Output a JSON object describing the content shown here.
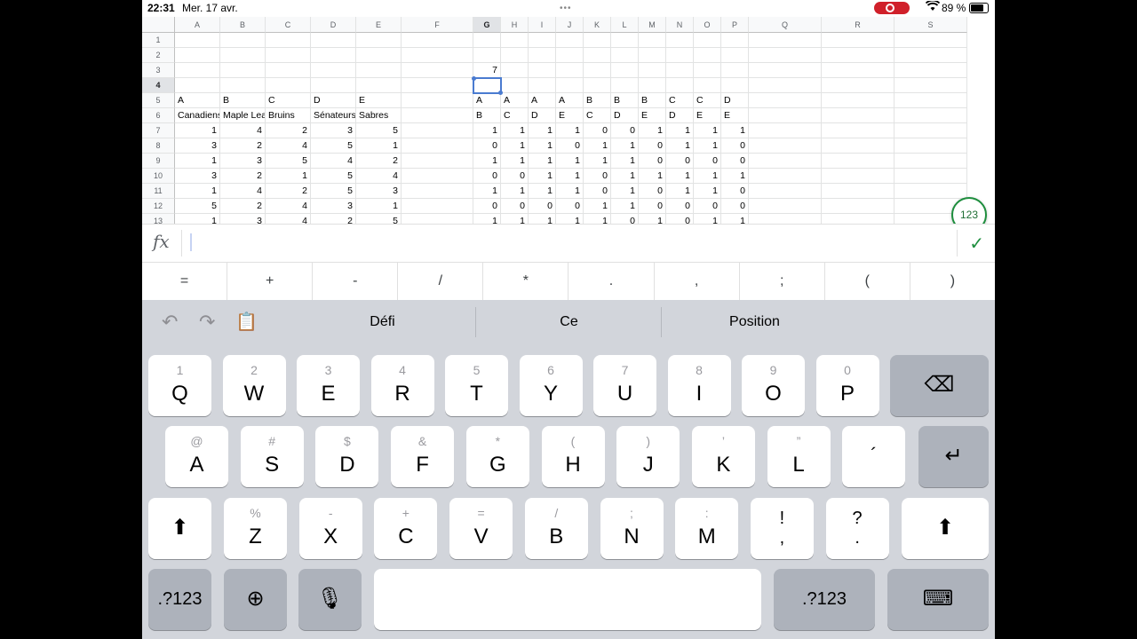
{
  "status": {
    "time": "22:31",
    "date": "Mer. 17 avr.",
    "battery": "89 %",
    "battery_level": 0.89,
    "dots": "•••"
  },
  "sheet": {
    "columns": [
      "A",
      "B",
      "C",
      "D",
      "E",
      "F",
      "G",
      "H",
      "I",
      "J",
      "K",
      "L",
      "M",
      "N",
      "O",
      "P",
      "Q",
      "R",
      "S"
    ],
    "rows": [
      "1",
      "2",
      "3",
      "4",
      "5",
      "6",
      "7",
      "8",
      "9",
      "10",
      "11",
      "12",
      "13"
    ],
    "selected_col": "G",
    "selected_row": "4",
    "g3_value": "7",
    "row5": [
      "A",
      "B",
      "C",
      "D",
      "E"
    ],
    "row6": [
      "Canadiens",
      "Maple Leafs",
      "Bruins",
      "Sénateurs",
      "Sabres"
    ],
    "rank_rows": [
      [
        "1",
        "4",
        "2",
        "3",
        "5"
      ],
      [
        "3",
        "2",
        "4",
        "5",
        "1"
      ],
      [
        "1",
        "3",
        "5",
        "4",
        "2"
      ],
      [
        "3",
        "2",
        "1",
        "5",
        "4"
      ],
      [
        "1",
        "4",
        "2",
        "5",
        "3"
      ],
      [
        "5",
        "2",
        "4",
        "3",
        "1"
      ],
      [
        "1",
        "3",
        "4",
        "2",
        "5"
      ]
    ],
    "pair_row5": [
      "A",
      "A",
      "A",
      "A",
      "B",
      "B",
      "B",
      "C",
      "C",
      "D"
    ],
    "pair_row6": [
      "B",
      "C",
      "D",
      "E",
      "C",
      "D",
      "E",
      "D",
      "E",
      "E"
    ],
    "pair_rows": [
      [
        "1",
        "1",
        "1",
        "1",
        "0",
        "0",
        "1",
        "1",
        "1",
        "1"
      ],
      [
        "0",
        "1",
        "1",
        "0",
        "1",
        "1",
        "0",
        "1",
        "1",
        "0"
      ],
      [
        "1",
        "1",
        "1",
        "1",
        "1",
        "1",
        "0",
        "0",
        "0",
        "0"
      ],
      [
        "0",
        "0",
        "1",
        "1",
        "0",
        "1",
        "1",
        "1",
        "1",
        "1"
      ],
      [
        "1",
        "1",
        "1",
        "1",
        "0",
        "1",
        "0",
        "1",
        "1",
        "0"
      ],
      [
        "0",
        "0",
        "0",
        "0",
        "1",
        "1",
        "0",
        "0",
        "0",
        "0"
      ],
      [
        "1",
        "1",
        "1",
        "1",
        "1",
        "0",
        "1",
        "0",
        "1",
        "1"
      ]
    ],
    "fab_label": "123"
  },
  "formula": {
    "fx": "fx",
    "check": "✓"
  },
  "symbols": [
    "=",
    "+",
    "-",
    "/",
    "*",
    ".",
    ",",
    ";",
    "(",
    ")"
  ],
  "keyboard": {
    "suggestions": [
      "Défi",
      "Ce",
      "Position"
    ],
    "row1": [
      {
        "alt": "1",
        "key": "Q"
      },
      {
        "alt": "2",
        "key": "W"
      },
      {
        "alt": "3",
        "key": "E"
      },
      {
        "alt": "4",
        "key": "R"
      },
      {
        "alt": "5",
        "key": "T"
      },
      {
        "alt": "6",
        "key": "Y"
      },
      {
        "alt": "7",
        "key": "U"
      },
      {
        "alt": "8",
        "key": "I"
      },
      {
        "alt": "9",
        "key": "O"
      },
      {
        "alt": "0",
        "key": "P"
      }
    ],
    "row2": [
      {
        "alt": "@",
        "key": "A"
      },
      {
        "alt": "#",
        "key": "S"
      },
      {
        "alt": "$",
        "key": "D"
      },
      {
        "alt": "&",
        "key": "F"
      },
      {
        "alt": "*",
        "key": "G"
      },
      {
        "alt": "(",
        "key": "H"
      },
      {
        "alt": ")",
        "key": "J"
      },
      {
        "alt": "’",
        "key": "K"
      },
      {
        "alt": "”",
        "key": "L"
      },
      {
        "alt": "",
        "key": "´"
      }
    ],
    "row3": [
      {
        "alt": "%",
        "key": "Z"
      },
      {
        "alt": "-",
        "key": "X"
      },
      {
        "alt": "+",
        "key": "C"
      },
      {
        "alt": "=",
        "key": "V"
      },
      {
        "alt": "/",
        "key": "B"
      },
      {
        "alt": ";",
        "key": "N"
      },
      {
        "alt": ":",
        "key": "M"
      },
      {
        "alt": "!",
        "key": ","
      },
      {
        "alt": "?",
        "key": "."
      }
    ],
    "numbers_label": ".?123",
    "icons": {
      "backspace": "⌫",
      "return": "↵",
      "shift": "⬆",
      "globe": "⊕",
      "mic": "🎙",
      "hide": "⌨",
      "undo": "↶",
      "redo": "↷",
      "paste": "📋"
    }
  }
}
